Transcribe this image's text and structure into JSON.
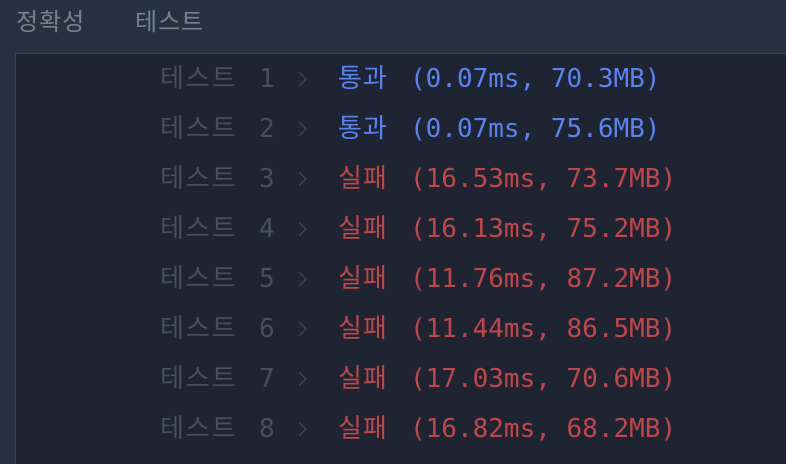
{
  "header": {
    "tabs": [
      {
        "label": "정확성"
      },
      {
        "label": "테스트"
      }
    ]
  },
  "colors": {
    "background": "#273142",
    "panel": "#1e2432",
    "muted_text": "#474f5e",
    "tab_text": "#78828f",
    "pass": "#5a82f0",
    "fail": "#c14649"
  },
  "tests": [
    {
      "label": "테스트",
      "number": "1",
      "status": "통과",
      "detail": "(0.07ms, 70.3MB)",
      "result": "pass"
    },
    {
      "label": "테스트",
      "number": "2",
      "status": "통과",
      "detail": "(0.07ms, 75.6MB)",
      "result": "pass"
    },
    {
      "label": "테스트",
      "number": "3",
      "status": "실패",
      "detail": "(16.53ms, 73.7MB)",
      "result": "fail"
    },
    {
      "label": "테스트",
      "number": "4",
      "status": "실패",
      "detail": "(16.13ms, 75.2MB)",
      "result": "fail"
    },
    {
      "label": "테스트",
      "number": "5",
      "status": "실패",
      "detail": "(11.76ms, 87.2MB)",
      "result": "fail"
    },
    {
      "label": "테스트",
      "number": "6",
      "status": "실패",
      "detail": "(11.44ms, 86.5MB)",
      "result": "fail"
    },
    {
      "label": "테스트",
      "number": "7",
      "status": "실패",
      "detail": "(17.03ms, 70.6MB)",
      "result": "fail"
    },
    {
      "label": "테스트",
      "number": "8",
      "status": "실패",
      "detail": "(16.82ms, 68.2MB)",
      "result": "fail"
    }
  ],
  "icons": {
    "row_chevron": "chevron-right-icon"
  }
}
